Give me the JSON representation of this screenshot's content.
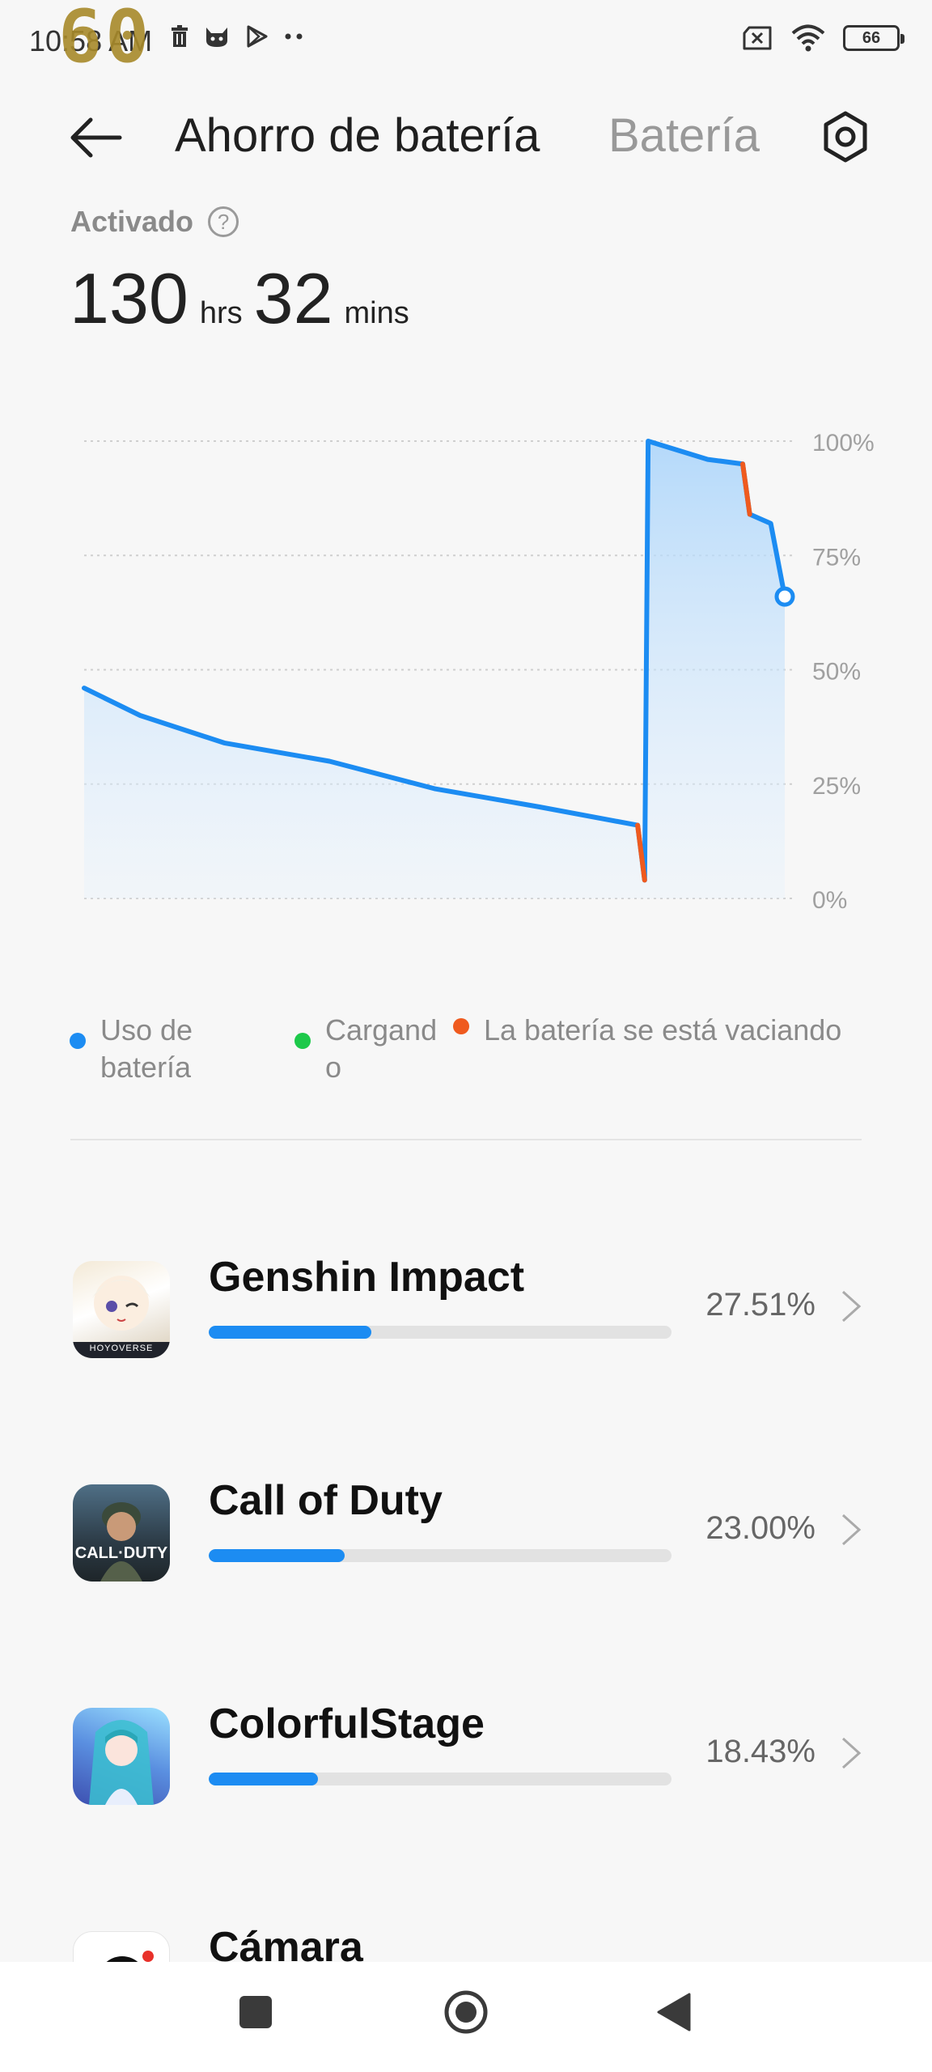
{
  "status_bar": {
    "time": "10:58 AM",
    "fps_overlay": "60",
    "battery_level": "66",
    "icons_left": [
      "trash-icon",
      "cat-icon",
      "play-store-icon",
      "more-dots-icon"
    ],
    "icons_right": [
      "no-sim-icon",
      "wifi-icon",
      "battery-icon"
    ]
  },
  "header": {
    "title": "Ahorro de batería",
    "tab_battery": "Batería"
  },
  "summary": {
    "activated_label": "Activado",
    "help_symbol": "?",
    "hours_value": "130",
    "hours_unit": "hrs",
    "minutes_value": "32",
    "minutes_unit": "mins"
  },
  "chart_data": {
    "type": "area",
    "y_ticks": [
      "100%",
      "75%",
      "50%",
      "25%",
      "0%"
    ],
    "ylim": [
      0,
      100
    ],
    "grid": true,
    "x_range": [
      0,
      100
    ],
    "series": [
      {
        "name": "Uso de batería",
        "color": "#1c8cf2",
        "points": [
          [
            0,
            46
          ],
          [
            8,
            40
          ],
          [
            20,
            34
          ],
          [
            35,
            30
          ],
          [
            50,
            24
          ],
          [
            65,
            20
          ],
          [
            79,
            16
          ],
          [
            80,
            4
          ],
          [
            80.5,
            100
          ],
          [
            89,
            96
          ],
          [
            94,
            95
          ],
          [
            95,
            84
          ],
          [
            98,
            82
          ],
          [
            100,
            66
          ]
        ]
      },
      {
        "name": "La batería se está vaciando",
        "color": "#ef5a1e",
        "segments": [
          [
            [
              79,
              16
            ],
            [
              80,
              4
            ]
          ],
          [
            [
              94,
              95
            ],
            [
              95,
              84
            ]
          ]
        ]
      }
    ],
    "current_marker": [
      100,
      66
    ]
  },
  "legend": {
    "usage_label": "Uso de\nbatería",
    "usage_color": "#1c8cf2",
    "charging_label": "Cargand\no",
    "charging_color": "#1dc94a",
    "draining_label": "La batería se está vaciando",
    "draining_color": "#ef5a1e"
  },
  "apps": [
    {
      "name": "Genshin Impact",
      "percent": "27.51%",
      "usage_fraction": 0.2751,
      "icon_text": "HOYOVERSE"
    },
    {
      "name": "Call of Duty",
      "percent": "23.00%",
      "usage_fraction": 0.23,
      "icon_text": "CALL·DUTY"
    },
    {
      "name": "ColorfulStage",
      "percent": "18.43%",
      "usage_fraction": 0.1843,
      "icon_text": ""
    },
    {
      "name": "Cámara",
      "percent": "",
      "usage_fraction": 0,
      "icon_text": ""
    }
  ],
  "nav_bar": {
    "buttons": [
      "recents-button",
      "home-button",
      "back-nav-button"
    ]
  }
}
